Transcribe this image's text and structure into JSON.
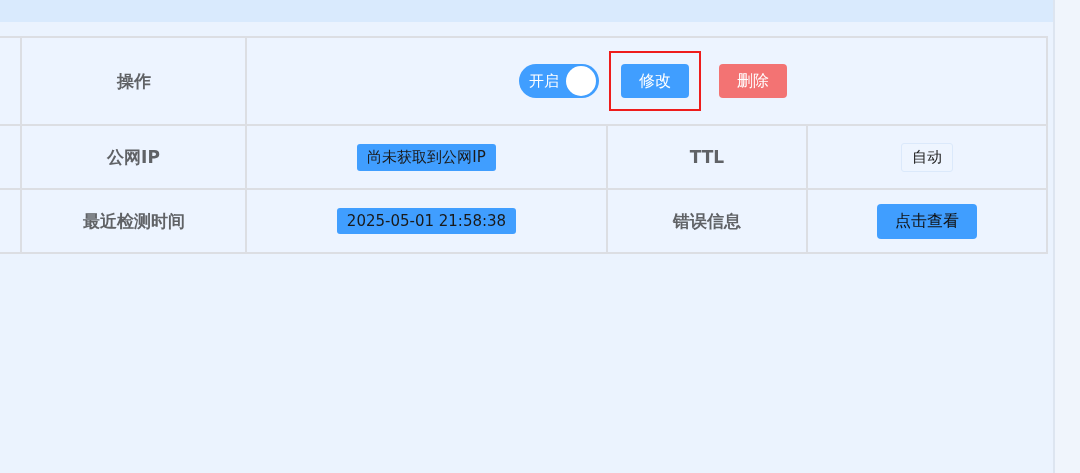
{
  "table": {
    "action_row": {
      "label": "操作",
      "toggle": {
        "label": "开启",
        "on": true
      },
      "buttons": [
        {
          "label": "修改",
          "kind": "primary",
          "highlighted": true
        },
        {
          "label": "删除",
          "kind": "danger",
          "highlighted": false
        }
      ]
    },
    "rows": [
      {
        "cells": [
          {
            "kind": "label",
            "text": "公网IP"
          },
          {
            "kind": "tag",
            "text": "尚未获取到公网IP"
          },
          {
            "kind": "label",
            "text": "TTL"
          },
          {
            "kind": "outline-tag",
            "text": "自动"
          }
        ]
      },
      {
        "cells": [
          {
            "kind": "label",
            "text": "最近检测时间"
          },
          {
            "kind": "tag",
            "text": "2025-05-01 21:58:38"
          },
          {
            "kind": "label",
            "text": "错误信息"
          },
          {
            "kind": "button",
            "text": "点击查看"
          }
        ]
      }
    ]
  }
}
